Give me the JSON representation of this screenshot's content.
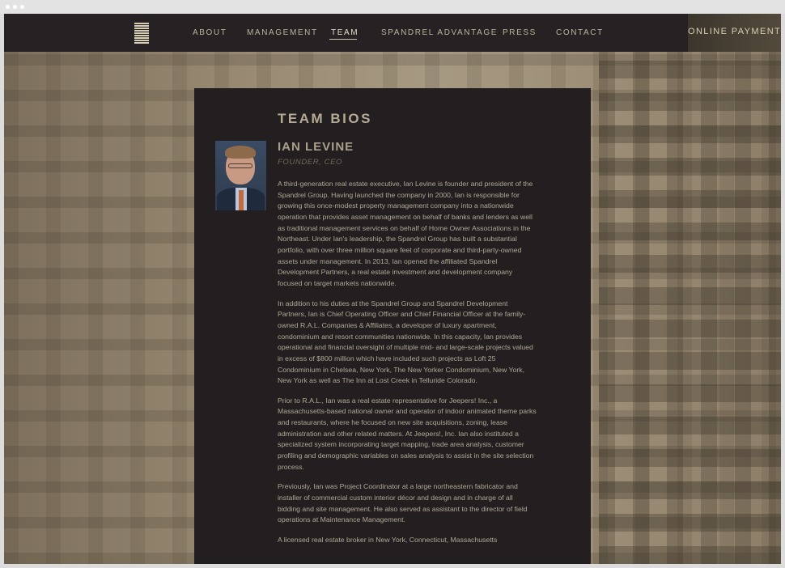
{
  "header": {
    "nav": [
      {
        "label": "ABOUT"
      },
      {
        "label": "MANAGEMENT"
      },
      {
        "label": "TEAM"
      },
      {
        "label": "SPANDREL ADVANTAGE"
      },
      {
        "label": "PRESS"
      },
      {
        "label": "CONTACT"
      }
    ],
    "active_nav": "TEAM",
    "payment_label": "ONLINE PAYMENT"
  },
  "main": {
    "title": "TEAM BIOS",
    "person": {
      "name": "IAN LEVINE",
      "role": "FOUNDER, CEO",
      "bio": [
        "A third-generation real estate executive, Ian Levine is founder and president of the Spandrel Group. Having launched the company in 2000, Ian is responsible for growing this once-modest property management company into a nationwide operation that provides asset management on behalf of banks and lenders as well as traditional management services on behalf of Home Owner Associations in the Northeast. Under Ian's leadership, the Spandrel Group has built a substantial portfolio, with over three million square feet of corporate and third-party-owned assets under management. In 2013, Ian opened the affiliated Spandrel Development Partners, a real estate investment and development company focused on target markets nationwide.",
        "In addition to his duties at the Spandrel Group and Spandrel Development Partners, Ian is Chief Operating Officer and Chief Financial Officer at the family-owned R.A.L. Companies & Affiliates, a developer of luxury apartment, condominium and resort communities nationwide. In this capacity, Ian provides operational and financial oversight of multiple mid- and large-scale projects valued in excess of $800 million which have included such projects as Loft 25 Condominium in Chelsea, New York, The New Yorker Condominium, New York, New York as well as The Inn at Lost Creek in Telluride Colorado.",
        "Prior to R.A.L., Ian was a real estate representative for Jeepers! Inc., a Massachusetts-based national owner and operator of indoor animated theme parks and restaurants, where he focused on new site acquisitions, zoning, lease administration and other related matters. At Jeepers!, Inc. Ian also instituted a specialized system incorporating target mapping, trade area analysis, customer profiling and demographic variables on sales analysis to assist in the site selection process.",
        "Previously, Ian was Project Coordinator at a large northeastern fabricator and installer of commercial custom interior décor and design and in charge of all bidding and site management. He also served as assistant to the director of field operations at Maintenance Management.",
        "A licensed real estate broker in New York, Connecticut, Massachusetts"
      ]
    }
  }
}
